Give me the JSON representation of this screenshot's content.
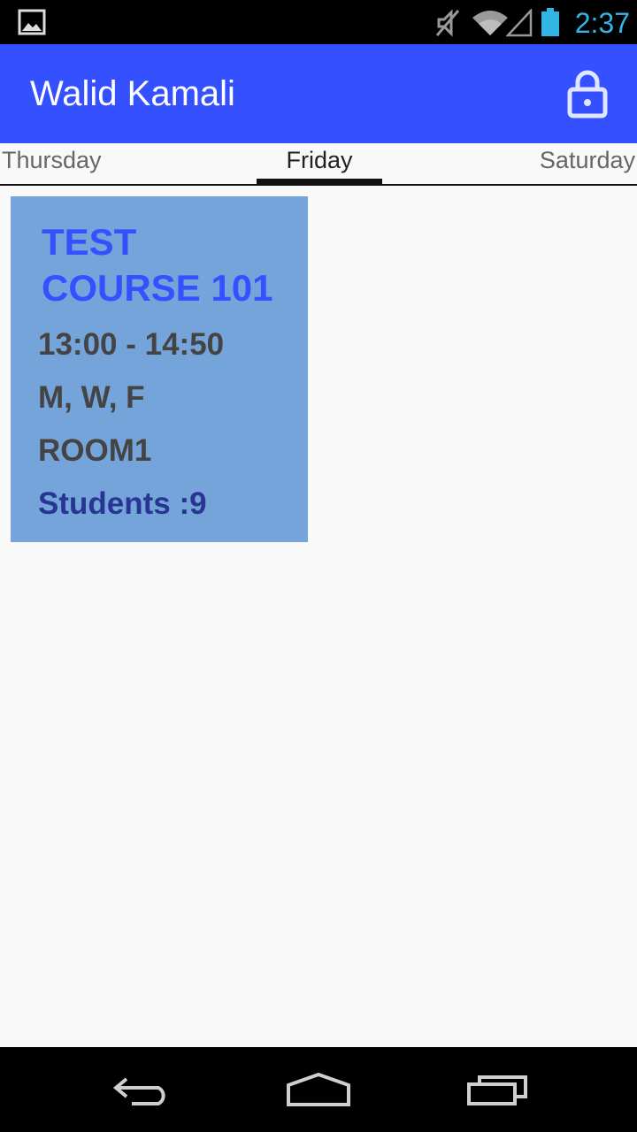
{
  "status_bar": {
    "time": "2:37",
    "icons": [
      "gallery-icon",
      "mute-icon",
      "wifi-icon",
      "signal-icon",
      "battery-icon"
    ],
    "clock_color": "#33b5e5"
  },
  "app_bar": {
    "title": "Walid Kamali",
    "action_icon": "lock-icon",
    "color": "#3550ff"
  },
  "tabs": {
    "items": [
      {
        "label": "Thursday"
      },
      {
        "label": "Friday"
      },
      {
        "label": "Saturday"
      }
    ],
    "selected": "Friday"
  },
  "courses": [
    {
      "title": "TEST COURSE 101",
      "time": "13:00 - 14:50",
      "days": "M, W, F",
      "room": "ROOM1",
      "students": "Students :9",
      "card_color": "#74a4d9",
      "title_color": "#3550ff"
    }
  ],
  "nav_bar": {
    "icons": [
      "back-icon",
      "home-icon",
      "recents-icon"
    ]
  }
}
